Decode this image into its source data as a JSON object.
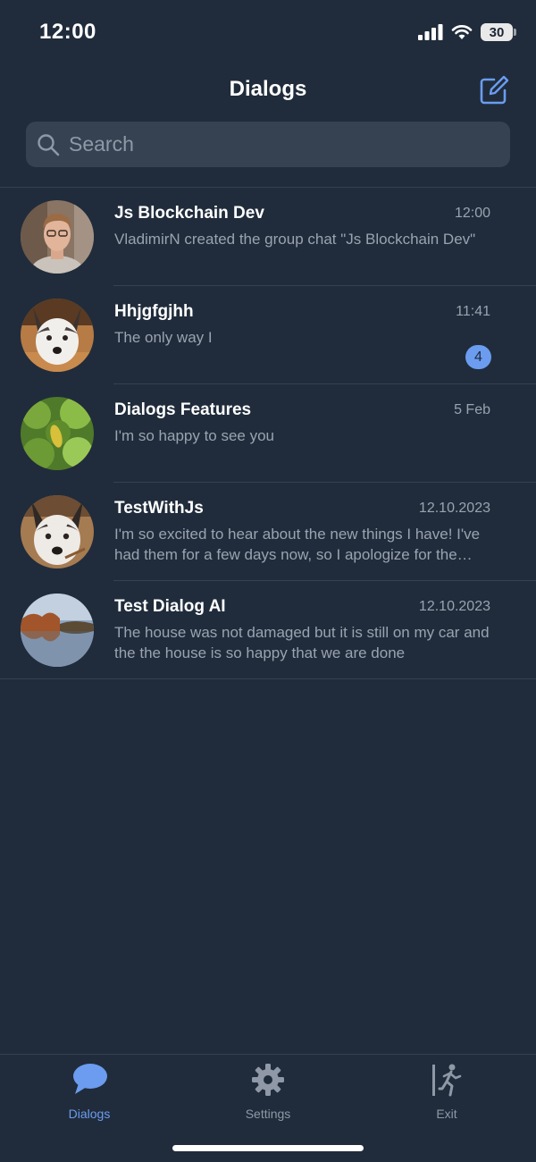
{
  "status_bar": {
    "time": "12:00",
    "battery": "30"
  },
  "header": {
    "title": "Dialogs",
    "compose_icon": "compose-icon"
  },
  "search": {
    "placeholder": "Search"
  },
  "dialogs": [
    {
      "name": "Js Blockchain Dev",
      "time": "12:00",
      "preview": "VladimirN created the group chat \"Js Blockchain Dev\"",
      "unread": null
    },
    {
      "name": "Hhjgfgjhh",
      "time": "11:41",
      "preview": "The only way I",
      "unread": "4"
    },
    {
      "name": "Dialogs Features",
      "time": "5 Feb",
      "preview": "I'm so happy to see you",
      "unread": null
    },
    {
      "name": "TestWithJs",
      "time": "12.10.2023",
      "preview": "I'm so excited to hear about the new things I have! I've had them for a few days now, so I apologize for the delay",
      "unread": null
    },
    {
      "name": "Test Dialog AI",
      "time": "12.10.2023",
      "preview": "The house was not damaged but it is still on my car and the the house is so happy that we are done",
      "unread": null
    }
  ],
  "tabs": [
    {
      "label": "Dialogs",
      "icon": "chat-bubble-icon",
      "active": true
    },
    {
      "label": "Settings",
      "icon": "gear-icon",
      "active": false
    },
    {
      "label": "Exit",
      "icon": "exit-icon",
      "active": false
    }
  ],
  "colors": {
    "background": "#202c3b",
    "accent": "#6b9cf0",
    "search_bg": "#364252",
    "secondary_text": "#9aa3b0"
  }
}
